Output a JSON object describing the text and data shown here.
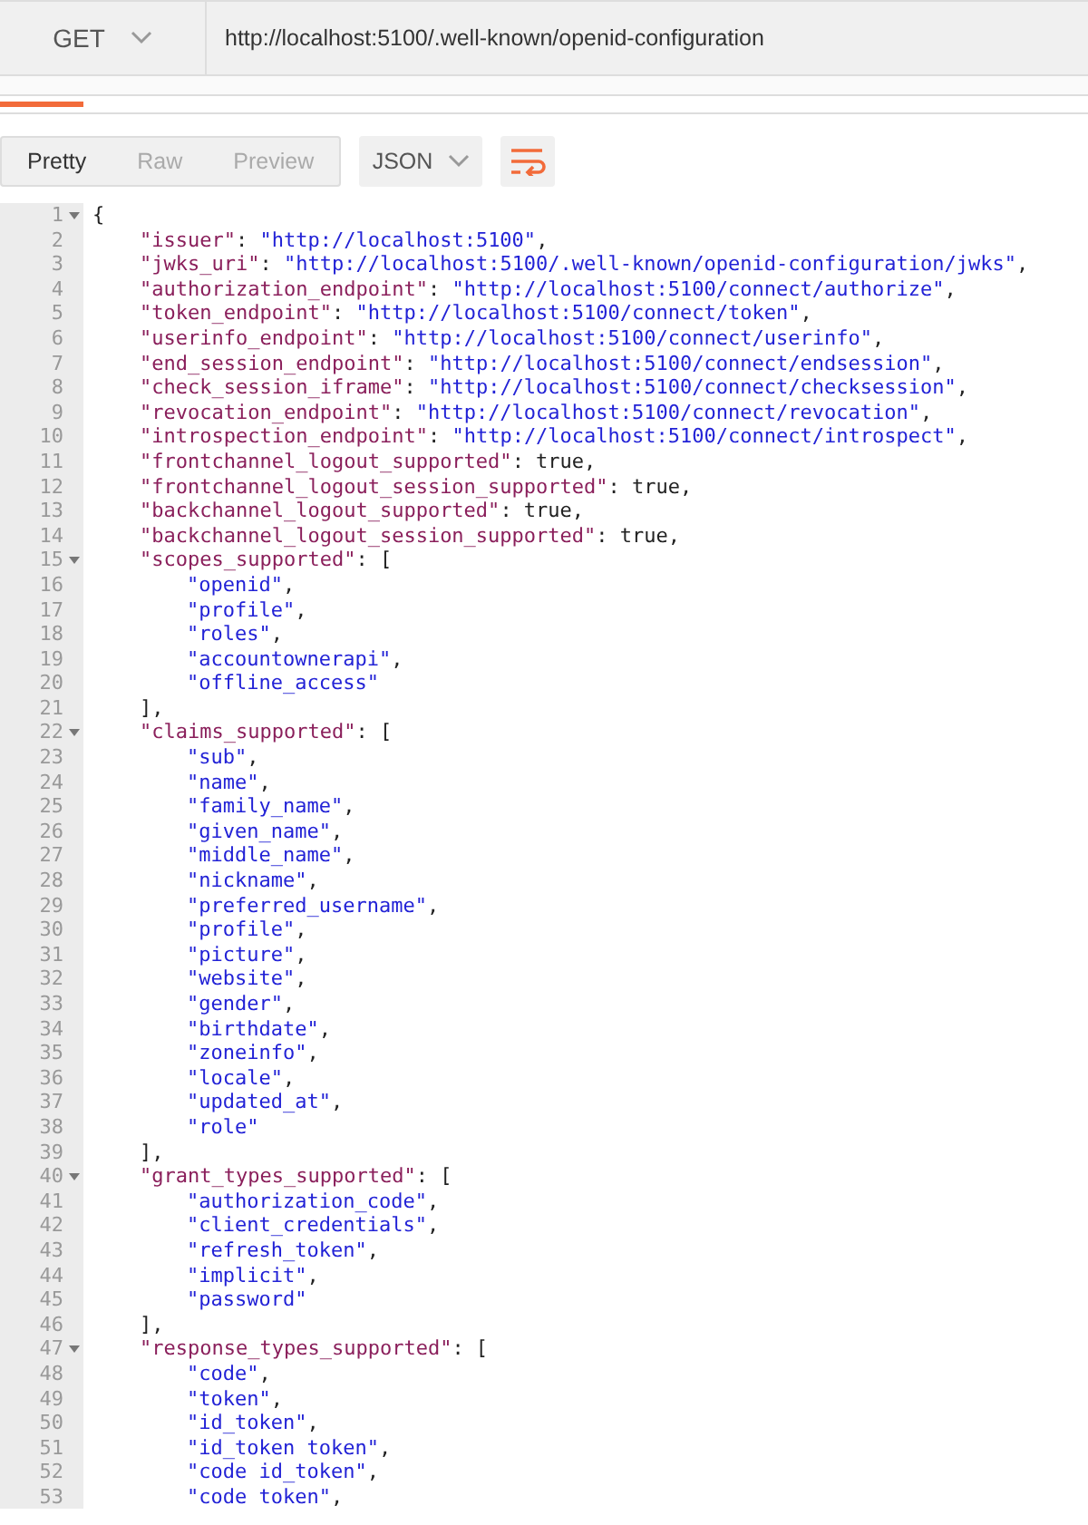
{
  "request": {
    "method": "GET",
    "url": "http://localhost:5100/.well-known/openid-configuration"
  },
  "view_tabs": [
    {
      "label": "Pretty",
      "selected": true
    },
    {
      "label": "Raw",
      "selected": false
    },
    {
      "label": "Preview",
      "selected": false
    }
  ],
  "format": "JSON",
  "code": [
    {
      "number": "1",
      "parts": [
        {
          "kind": "punct",
          "text": "{"
        }
      ],
      "children": [
        {
          "number": "2",
          "parts": [
            {
              "kind": "key",
              "text": "\"issuer\""
            },
            {
              "kind": "punct",
              "text": ": "
            },
            {
              "kind": "string",
              "text": "\"http://localhost:5100\""
            },
            {
              "kind": "punct",
              "text": ","
            }
          ]
        },
        {
          "number": "3",
          "parts": [
            {
              "kind": "key",
              "text": "\"jwks_uri\""
            },
            {
              "kind": "punct",
              "text": ": "
            },
            {
              "kind": "string",
              "text": "\"http://localhost:5100/.well-known/openid-configuration/jwks\""
            },
            {
              "kind": "punct",
              "text": ","
            }
          ]
        },
        {
          "number": "4",
          "parts": [
            {
              "kind": "key",
              "text": "\"authorization_endpoint\""
            },
            {
              "kind": "punct",
              "text": ": "
            },
            {
              "kind": "string",
              "text": "\"http://localhost:5100/connect/authorize\""
            },
            {
              "kind": "punct",
              "text": ","
            }
          ]
        },
        {
          "number": "5",
          "parts": [
            {
              "kind": "key",
              "text": "\"token_endpoint\""
            },
            {
              "kind": "punct",
              "text": ": "
            },
            {
              "kind": "string",
              "text": "\"http://localhost:5100/connect/token\""
            },
            {
              "kind": "punct",
              "text": ","
            }
          ]
        },
        {
          "number": "6",
          "parts": [
            {
              "kind": "key",
              "text": "\"userinfo_endpoint\""
            },
            {
              "kind": "punct",
              "text": ": "
            },
            {
              "kind": "string",
              "text": "\"http://localhost:5100/connect/userinfo\""
            },
            {
              "kind": "punct",
              "text": ","
            }
          ]
        },
        {
          "number": "7",
          "parts": [
            {
              "kind": "key",
              "text": "\"end_session_endpoint\""
            },
            {
              "kind": "punct",
              "text": ": "
            },
            {
              "kind": "string",
              "text": "\"http://localhost:5100/connect/endsession\""
            },
            {
              "kind": "punct",
              "text": ","
            }
          ]
        },
        {
          "number": "8",
          "parts": [
            {
              "kind": "key",
              "text": "\"check_session_iframe\""
            },
            {
              "kind": "punct",
              "text": ": "
            },
            {
              "kind": "string",
              "text": "\"http://localhost:5100/connect/checksession\""
            },
            {
              "kind": "punct",
              "text": ","
            }
          ]
        },
        {
          "number": "9",
          "parts": [
            {
              "kind": "key",
              "text": "\"revocation_endpoint\""
            },
            {
              "kind": "punct",
              "text": ": "
            },
            {
              "kind": "string",
              "text": "\"http://localhost:5100/connect/revocation\""
            },
            {
              "kind": "punct",
              "text": ","
            }
          ]
        },
        {
          "number": "10",
          "parts": [
            {
              "kind": "key",
              "text": "\"introspection_endpoint\""
            },
            {
              "kind": "punct",
              "text": ": "
            },
            {
              "kind": "string",
              "text": "\"http://localhost:5100/connect/introspect\""
            },
            {
              "kind": "punct",
              "text": ","
            }
          ]
        },
        {
          "number": "11",
          "parts": [
            {
              "kind": "key",
              "text": "\"frontchannel_logout_supported\""
            },
            {
              "kind": "punct",
              "text": ": true,"
            }
          ]
        },
        {
          "number": "12",
          "parts": [
            {
              "kind": "key",
              "text": "\"frontchannel_logout_session_supported\""
            },
            {
              "kind": "punct",
              "text": ": true,"
            }
          ]
        },
        {
          "number": "13",
          "parts": [
            {
              "kind": "key",
              "text": "\"backchannel_logout_supported\""
            },
            {
              "kind": "punct",
              "text": ": true,"
            }
          ]
        },
        {
          "number": "14",
          "parts": [
            {
              "kind": "key",
              "text": "\"backchannel_logout_session_supported\""
            },
            {
              "kind": "punct",
              "text": ": true,"
            }
          ]
        },
        {
          "number": "15",
          "parts": [
            {
              "kind": "key",
              "text": "\"scopes_supported\""
            },
            {
              "kind": "punct",
              "text": ": ["
            }
          ],
          "children": [
            {
              "number": "16",
              "parts": [
                {
                  "kind": "string",
                  "text": "\"openid\""
                },
                {
                  "kind": "punct",
                  "text": ","
                }
              ]
            },
            {
              "number": "17",
              "parts": [
                {
                  "kind": "string",
                  "text": "\"profile\""
                },
                {
                  "kind": "punct",
                  "text": ","
                }
              ]
            },
            {
              "number": "18",
              "parts": [
                {
                  "kind": "string",
                  "text": "\"roles\""
                },
                {
                  "kind": "punct",
                  "text": ","
                }
              ]
            },
            {
              "number": "19",
              "parts": [
                {
                  "kind": "string",
                  "text": "\"accountownerapi\""
                },
                {
                  "kind": "punct",
                  "text": ","
                }
              ]
            },
            {
              "number": "20",
              "parts": [
                {
                  "kind": "string",
                  "text": "\"offline_access\""
                }
              ]
            }
          ]
        },
        {
          "number": "21",
          "parts": [
            {
              "kind": "punct",
              "text": "],"
            }
          ]
        },
        {
          "number": "22",
          "parts": [
            {
              "kind": "key",
              "text": "\"claims_supported\""
            },
            {
              "kind": "punct",
              "text": ": ["
            }
          ],
          "children": [
            {
              "number": "23",
              "parts": [
                {
                  "kind": "string",
                  "text": "\"sub\""
                },
                {
                  "kind": "punct",
                  "text": ","
                }
              ]
            },
            {
              "number": "24",
              "parts": [
                {
                  "kind": "string",
                  "text": "\"name\""
                },
                {
                  "kind": "punct",
                  "text": ","
                }
              ]
            },
            {
              "number": "25",
              "parts": [
                {
                  "kind": "string",
                  "text": "\"family_name\""
                },
                {
                  "kind": "punct",
                  "text": ","
                }
              ]
            },
            {
              "number": "26",
              "parts": [
                {
                  "kind": "string",
                  "text": "\"given_name\""
                },
                {
                  "kind": "punct",
                  "text": ","
                }
              ]
            },
            {
              "number": "27",
              "parts": [
                {
                  "kind": "string",
                  "text": "\"middle_name\""
                },
                {
                  "kind": "punct",
                  "text": ","
                }
              ]
            },
            {
              "number": "28",
              "parts": [
                {
                  "kind": "string",
                  "text": "\"nickname\""
                },
                {
                  "kind": "punct",
                  "text": ","
                }
              ]
            },
            {
              "number": "29",
              "parts": [
                {
                  "kind": "string",
                  "text": "\"preferred_username\""
                },
                {
                  "kind": "punct",
                  "text": ","
                }
              ]
            },
            {
              "number": "30",
              "parts": [
                {
                  "kind": "string",
                  "text": "\"profile\""
                },
                {
                  "kind": "punct",
                  "text": ","
                }
              ]
            },
            {
              "number": "31",
              "parts": [
                {
                  "kind": "string",
                  "text": "\"picture\""
                },
                {
                  "kind": "punct",
                  "text": ","
                }
              ]
            },
            {
              "number": "32",
              "parts": [
                {
                  "kind": "string",
                  "text": "\"website\""
                },
                {
                  "kind": "punct",
                  "text": ","
                }
              ]
            },
            {
              "number": "33",
              "parts": [
                {
                  "kind": "string",
                  "text": "\"gender\""
                },
                {
                  "kind": "punct",
                  "text": ","
                }
              ]
            },
            {
              "number": "34",
              "parts": [
                {
                  "kind": "string",
                  "text": "\"birthdate\""
                },
                {
                  "kind": "punct",
                  "text": ","
                }
              ]
            },
            {
              "number": "35",
              "parts": [
                {
                  "kind": "string",
                  "text": "\"zoneinfo\""
                },
                {
                  "kind": "punct",
                  "text": ","
                }
              ]
            },
            {
              "number": "36",
              "parts": [
                {
                  "kind": "string",
                  "text": "\"locale\""
                },
                {
                  "kind": "punct",
                  "text": ","
                }
              ]
            },
            {
              "number": "37",
              "parts": [
                {
                  "kind": "string",
                  "text": "\"updated_at\""
                },
                {
                  "kind": "punct",
                  "text": ","
                }
              ]
            },
            {
              "number": "38",
              "parts": [
                {
                  "kind": "string",
                  "text": "\"role\""
                }
              ]
            }
          ]
        },
        {
          "number": "39",
          "parts": [
            {
              "kind": "punct",
              "text": "],"
            }
          ]
        },
        {
          "number": "40",
          "parts": [
            {
              "kind": "key",
              "text": "\"grant_types_supported\""
            },
            {
              "kind": "punct",
              "text": ": ["
            }
          ],
          "children": [
            {
              "number": "41",
              "parts": [
                {
                  "kind": "string",
                  "text": "\"authorization_code\""
                },
                {
                  "kind": "punct",
                  "text": ","
                }
              ]
            },
            {
              "number": "42",
              "parts": [
                {
                  "kind": "string",
                  "text": "\"client_credentials\""
                },
                {
                  "kind": "punct",
                  "text": ","
                }
              ]
            },
            {
              "number": "43",
              "parts": [
                {
                  "kind": "string",
                  "text": "\"refresh_token\""
                },
                {
                  "kind": "punct",
                  "text": ","
                }
              ]
            },
            {
              "number": "44",
              "parts": [
                {
                  "kind": "string",
                  "text": "\"implicit\""
                },
                {
                  "kind": "punct",
                  "text": ","
                }
              ]
            },
            {
              "number": "45",
              "parts": [
                {
                  "kind": "string",
                  "text": "\"password\""
                }
              ]
            }
          ]
        },
        {
          "number": "46",
          "parts": [
            {
              "kind": "punct",
              "text": "],"
            }
          ]
        },
        {
          "number": "47",
          "parts": [
            {
              "kind": "key",
              "text": "\"response_types_supported\""
            },
            {
              "kind": "punct",
              "text": ": ["
            }
          ],
          "children": [
            {
              "number": "48",
              "parts": [
                {
                  "kind": "string",
                  "text": "\"code\""
                },
                {
                  "kind": "punct",
                  "text": ","
                }
              ]
            },
            {
              "number": "49",
              "parts": [
                {
                  "kind": "string",
                  "text": "\"token\""
                },
                {
                  "kind": "punct",
                  "text": ","
                }
              ]
            },
            {
              "number": "50",
              "parts": [
                {
                  "kind": "string",
                  "text": "\"id_token\""
                },
                {
                  "kind": "punct",
                  "text": ","
                }
              ]
            },
            {
              "number": "51",
              "parts": [
                {
                  "kind": "string",
                  "text": "\"id_token token\""
                },
                {
                  "kind": "punct",
                  "text": ","
                }
              ]
            },
            {
              "number": "52",
              "parts": [
                {
                  "kind": "string",
                  "text": "\"code id_token\""
                },
                {
                  "kind": "punct",
                  "text": ","
                }
              ]
            },
            {
              "number": "53",
              "parts": [
                {
                  "kind": "string",
                  "text": "\"code token\""
                },
                {
                  "kind": "punct",
                  "text": ","
                }
              ]
            }
          ]
        }
      ]
    }
  ]
}
